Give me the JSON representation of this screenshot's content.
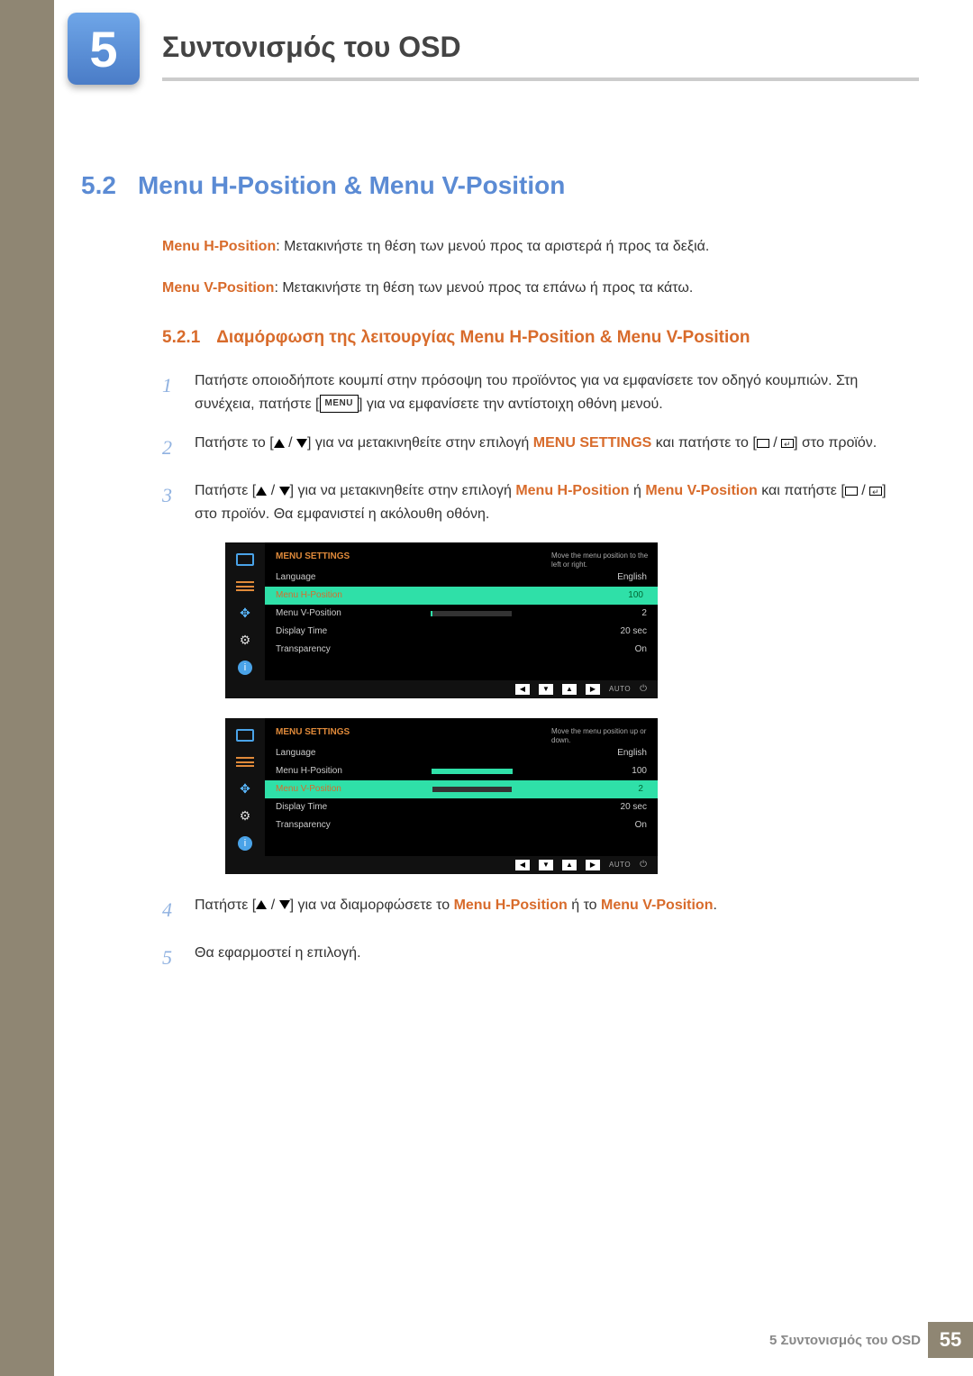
{
  "chapter": {
    "number": "5",
    "title": "Συντονισμός του OSD"
  },
  "section": {
    "number": "5.2",
    "title": "Menu H-Position & Menu V-Position"
  },
  "desc_h": {
    "label": "Menu H-Position",
    "text": ": Μετακινήστε τη θέση των μενού προς τα αριστερά ή προς τα δεξιά."
  },
  "desc_v": {
    "label": "Menu V-Position",
    "text": ": Μετακινήστε τη θέση των μενού προς τα επάνω ή προς τα κάτω."
  },
  "subsection": {
    "number": "5.2.1",
    "title": "Διαμόρφωση της λειτουργίας Menu H-Position & Menu V-Position"
  },
  "steps": {
    "s1a": "Πατήστε οποιοδήποτε κουμπί στην πρόσοψη του προϊόντος για να εμφανίσετε τον οδηγό κουμπιών. Στη συνέχεια, πατήστε ",
    "s1b": " για να εμφανίσετε την αντίστοιχη οθόνη μενού.",
    "s2a": "Πατήστε το [",
    "s2b": "] για να μετακινηθείτε στην επιλογή ",
    "s2c": " και πατήστε το [",
    "s2d": "] στο προϊόν.",
    "s2hl": "MENU SETTINGS",
    "s3a": "Πατήστε [",
    "s3b": "] για να μετακινηθείτε στην επιλογή ",
    "s3hl1": "Menu H-Position",
    "s3or": " ή ",
    "s3hl2": "Menu V-Position",
    "s3c": " και πατήστε [",
    "s3d": "] στο προϊόν. Θα εμφανιστεί η ακόλουθη οθόνη.",
    "s4a": "Πατήστε [",
    "s4b": "] για να διαμορφώσετε το ",
    "s4hl1": "Menu H-Position",
    "s4or": " ή το ",
    "s4hl2": "Menu V-Position",
    "s4c": ".",
    "s5": "Θα εφαρμοστεί η επιλογή.",
    "menu_inline": "MENU"
  },
  "osd1": {
    "title": "MENU SETTINGS",
    "help": "Move the menu position to the left or right.",
    "rows": [
      {
        "label": "Language",
        "value": "English",
        "bar": null,
        "sel": false
      },
      {
        "label": "Menu H-Position",
        "value": "100",
        "bar": 100,
        "sel": true
      },
      {
        "label": "Menu V-Position",
        "value": "2",
        "bar": 2,
        "sel": false
      },
      {
        "label": "Display Time",
        "value": "20 sec",
        "bar": null,
        "sel": false
      },
      {
        "label": "Transparency",
        "value": "On",
        "bar": null,
        "sel": false
      }
    ],
    "auto": "AUTO"
  },
  "osd2": {
    "title": "MENU SETTINGS",
    "help": "Move the menu position up or down.",
    "rows": [
      {
        "label": "Language",
        "value": "English",
        "bar": null,
        "sel": false
      },
      {
        "label": "Menu H-Position",
        "value": "100",
        "bar": 100,
        "sel": false
      },
      {
        "label": "Menu V-Position",
        "value": "2",
        "bar": 2,
        "sel": true
      },
      {
        "label": "Display Time",
        "value": "20 sec",
        "bar": null,
        "sel": false
      },
      {
        "label": "Transparency",
        "value": "On",
        "bar": null,
        "sel": false
      }
    ],
    "auto": "AUTO"
  },
  "footer": {
    "text": "5 Συντονισμός του OSD",
    "page": "55"
  }
}
